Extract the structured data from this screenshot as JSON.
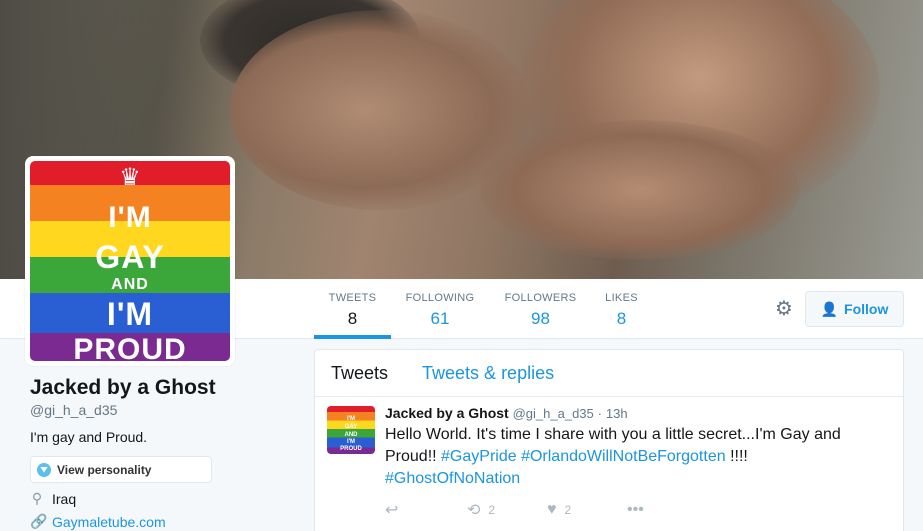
{
  "profile": {
    "name": "Jacked by a Ghost",
    "handle": "@gi_h_a_d35",
    "bio": "I'm gay and Proud.",
    "personality_button": "View personality",
    "location": "Iraq",
    "website": "Gaymaletube.com",
    "avatar_text": {
      "line1": "I'M",
      "line2": "GAY",
      "line3": "AND",
      "line4": "I'M",
      "line5": "PROUD"
    }
  },
  "nav": {
    "stats": [
      {
        "label": "TWEETS",
        "value": "8"
      },
      {
        "label": "FOLLOWING",
        "value": "61"
      },
      {
        "label": "FOLLOWERS",
        "value": "98"
      },
      {
        "label": "LIKES",
        "value": "8"
      }
    ],
    "follow_label": "Follow"
  },
  "timeline": {
    "tabs": [
      "Tweets",
      "Tweets & replies"
    ],
    "tweet": {
      "name": "Jacked by a Ghost",
      "handle": "@gi_h_a_d35",
      "time": "13h",
      "text_part1": "Hello World. It's time I share with you a little secret...I'm Gay and Proud!! ",
      "hashtag1": "#GayPride",
      "hashtag2": "#OrlandoWillNotBeForgotten",
      "text_part2": " !!!!",
      "hashtag3": "#GhostOfNoNation",
      "retweets": "2",
      "likes": "2"
    }
  },
  "colors": {
    "link_blue": "#1b95e0",
    "muted": "#657786",
    "background": "#f5f8fa"
  },
  "icons": [
    "gear-icon",
    "follow-user-icon",
    "personality-gem-icon",
    "location-pin-icon",
    "link-icon",
    "reply-icon",
    "retweet-icon",
    "heart-icon",
    "more-icon",
    "crown-icon"
  ]
}
